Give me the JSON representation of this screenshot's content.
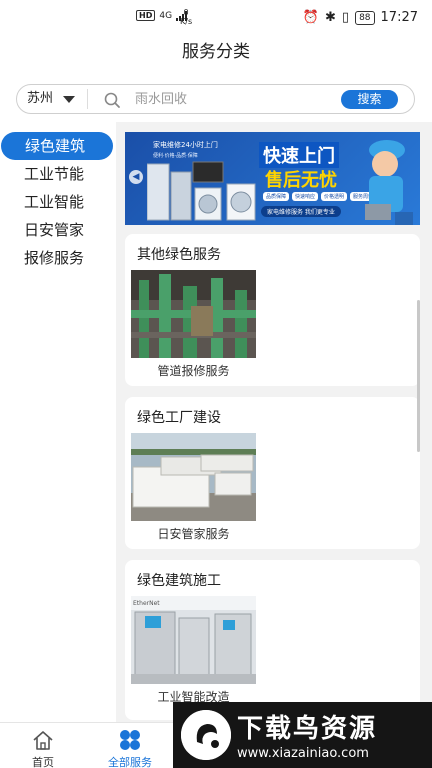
{
  "status_bar": {
    "left_badge": "HD",
    "network": "4G",
    "speed_value": "0",
    "speed_unit": "K/s",
    "battery": "88",
    "time": "17:27"
  },
  "header": {
    "title": "服务分类"
  },
  "search": {
    "city": "苏州",
    "placeholder": "雨水回收",
    "button_label": "搜索"
  },
  "sidebar": {
    "items": [
      {
        "label": "绿色建筑",
        "active": true
      },
      {
        "label": "工业节能",
        "active": false
      },
      {
        "label": "工业智能",
        "active": false
      },
      {
        "label": "日安管家",
        "active": false
      },
      {
        "label": "报修服务",
        "active": false
      }
    ]
  },
  "banner": {
    "small_text": "家电维修24小时上门",
    "tiny_text": "便利·价格·品质·保障",
    "title_line1": "快速上门",
    "title_line2": "售后无忧",
    "tags": [
      "品质保障",
      "快速响应",
      "价格透明",
      "服务周到"
    ],
    "pill_text": "家电维修服务 我们更专业"
  },
  "cards": [
    {
      "title": "其他绿色服务",
      "caption": "管道报修服务"
    },
    {
      "title": "绿色工厂建设",
      "caption": "日安管家服务"
    },
    {
      "title": "绿色建筑施工",
      "caption": "工业智能改造"
    }
  ],
  "tabbar": {
    "items": [
      {
        "label": "首页",
        "active": false
      },
      {
        "label": "全部服务",
        "active": true
      }
    ]
  },
  "watermark": {
    "title": "下载鸟资源",
    "url": "www.xiazainiao.com"
  },
  "colors": {
    "accent": "#1b75d8",
    "background": "#f2f2f2",
    "banner_yellow": "#ffd400"
  }
}
